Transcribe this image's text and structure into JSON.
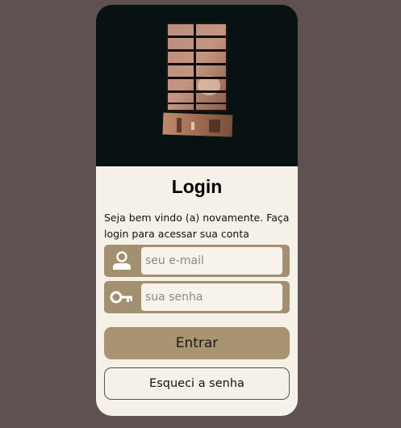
{
  "login": {
    "title": "Login",
    "subtitle": "Seja bem vindo (a) novamente. Faça login para acessar sua conta",
    "email": {
      "placeholder": "seu e-mail",
      "value": "",
      "icon": "person-icon"
    },
    "password": {
      "placeholder": "sua senha",
      "value": "",
      "icon": "key-icon"
    },
    "submit_label": "Entrar",
    "forgot_label": "Esqueci a senha"
  },
  "colors": {
    "page_background": "#5f5151",
    "card_background": "#f5f0e8",
    "accent": "#a89470",
    "hero_background": "#091212"
  }
}
